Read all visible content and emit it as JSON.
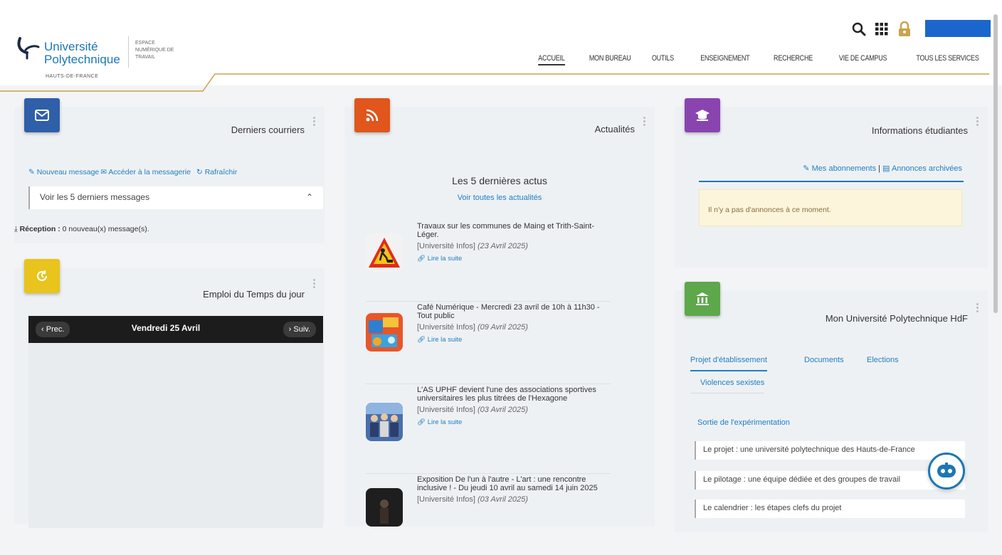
{
  "header": {
    "logo_line1": "Université",
    "logo_line2": "Polytechnique",
    "logo_line3": "HAUTS-DE-FRANCE",
    "ent_line1": "Espace",
    "ent_line2": "Numérique de",
    "ent_line3": "Travail",
    "nav": [
      "ACCUEIL",
      "MON BUREAU",
      "OUTILS",
      "ENSEIGNEMENT",
      "RECHERCHE",
      "VIE DE CAMPUS",
      "TOUS LES SERVICES"
    ],
    "accent_color": "#c8a44a",
    "brand_color": "#1c77b4"
  },
  "mail": {
    "title": "Derniers courriers",
    "new_message": "Nouveau message",
    "open_mailbox": "Accéder à la messagerie",
    "refresh": "Rafraîchir",
    "last5": "Voir les 5 derniers messages",
    "reception_label": "Réception :",
    "reception_value": "0 nouveau(x) message(s).",
    "badge_color": "#2f5fa8"
  },
  "timetable": {
    "title": "Emploi du Temps du jour",
    "prev": "Prec.",
    "next": "Suiv.",
    "date": "Vendredi 25 Avril",
    "badge_color": "#e8c41c"
  },
  "news": {
    "title": "Actualités",
    "heading": "Les 5 dernières actus",
    "see_all": "Voir toutes les actualités",
    "read_more": "Lire la suite",
    "badge_color": "#e0561c",
    "items": [
      {
        "title": "Travaux sur les communes de Maing et Trith-Saint-Léger.",
        "source": "[Université Infos]",
        "date": "(23 Avril 2025)"
      },
      {
        "title": "Café Numérique - Mercredi 23 avril de 10h à 11h30 - Tout public",
        "source": "[Université Infos]",
        "date": "(09 Avril 2025)"
      },
      {
        "title": "L'AS UPHF devient l'une des associations sportives universitaires les plus titrées de l'Hexagone",
        "source": "[Université Infos]",
        "date": "(03 Avril 2025)"
      },
      {
        "title": "Exposition De l'un à l'autre - L'art : une rencontre inclusive ! - Du jeudi 10 avril au samedi 14 juin 2025",
        "source": "[Université Infos]",
        "date": "(03 Avril 2025)"
      }
    ]
  },
  "info": {
    "title": "Informations étudiantes",
    "subscriptions": "Mes abonnements",
    "separator": "|",
    "archived": "Annonces archivées",
    "empty": "Il n'y a pas d'annonces à ce moment.",
    "badge_color": "#8a44b0"
  },
  "univ": {
    "title": "Mon Université Polytechnique HdF",
    "tabs": [
      "Projet d'établissement",
      "Documents",
      "Elections",
      "Violences sexistes"
    ],
    "sortie": "Sortie de l'expérimentation",
    "links": [
      "Le projet : une université polytechnique des Hauts-de-France",
      "Le pilotage : une équipe dédiée et des groupes de travail",
      "Le calendrier : les étapes clefs du projet"
    ],
    "badge_color": "#5ca84a"
  }
}
